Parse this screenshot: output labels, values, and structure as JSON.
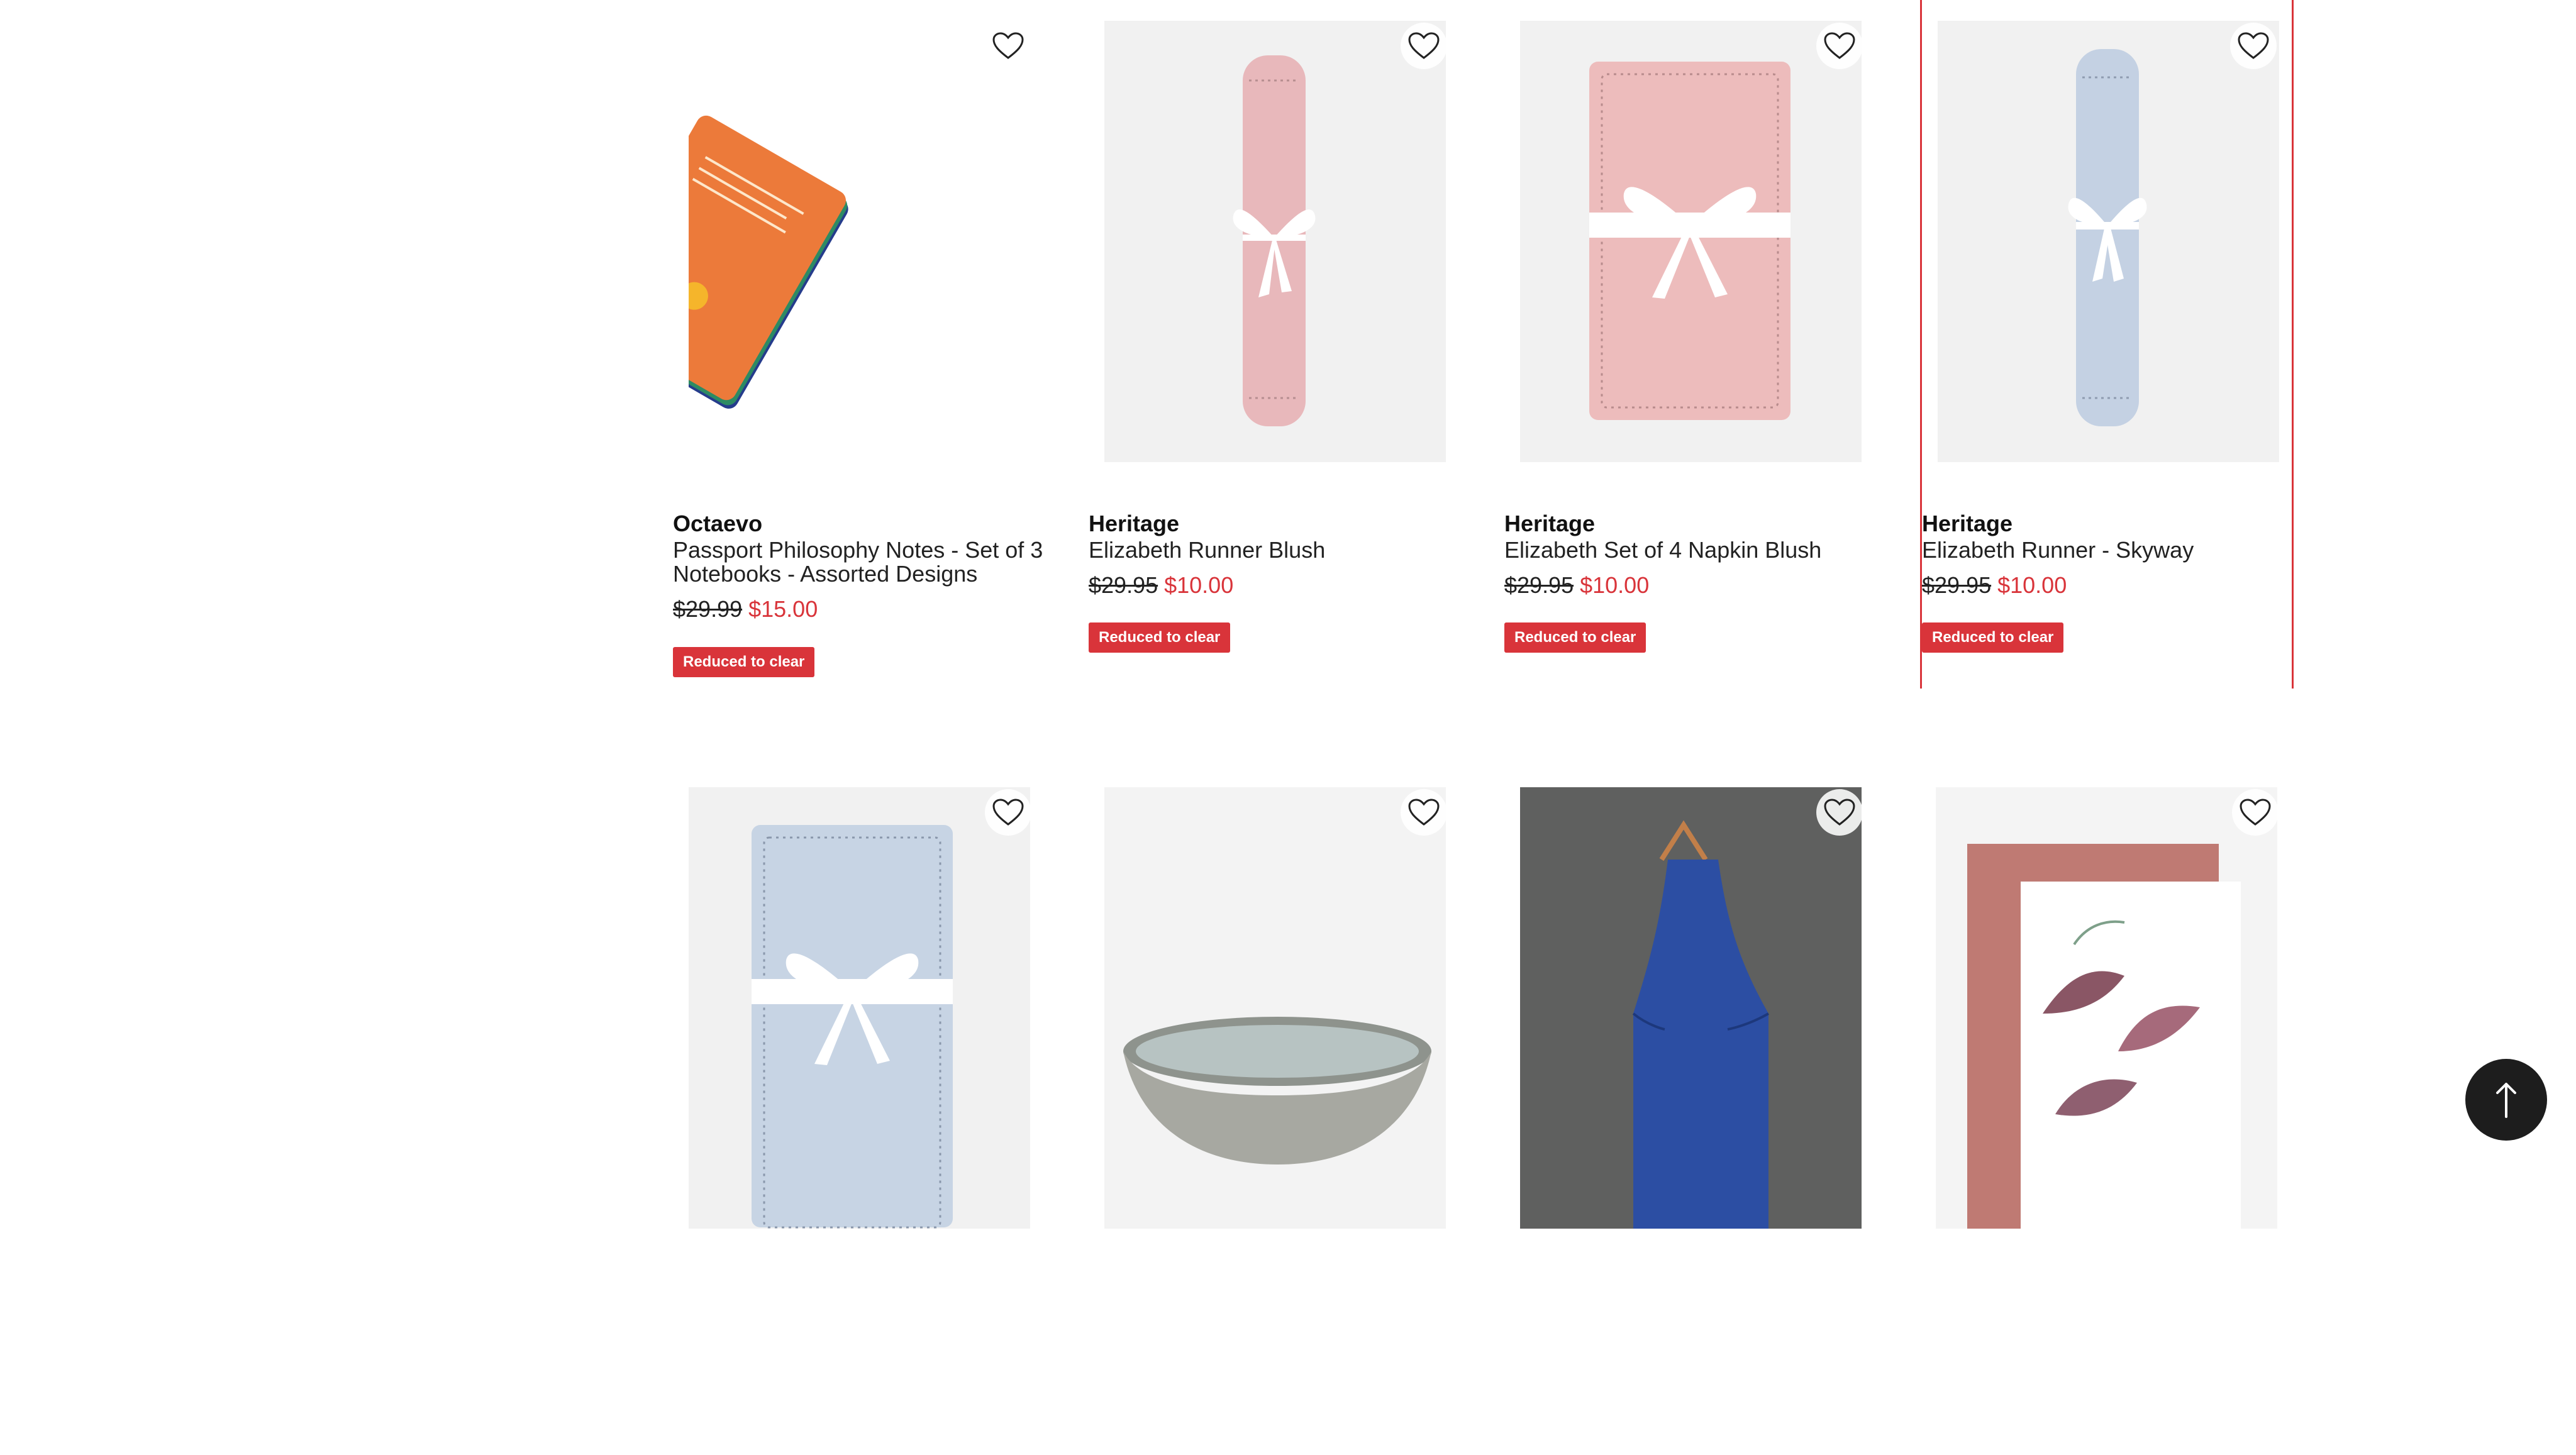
{
  "products": [
    {
      "brand": "Octaevo",
      "title": "Passport Philosophy Notes - Set of 3 Notebooks - Assorted Designs",
      "price_old": "$29.99",
      "price_new": "$15.00",
      "badge": "Reduced to clear",
      "image": "orange-notebook-set"
    },
    {
      "brand": "Heritage",
      "title": "Elizabeth Runner Blush",
      "price_old": "$29.95",
      "price_new": "$10.00",
      "badge": "Reduced to clear",
      "image": "pink-rolled-runner"
    },
    {
      "brand": "Heritage",
      "title": "Elizabeth Set of 4 Napkin Blush",
      "price_old": "$29.95",
      "price_new": "$10.00",
      "badge": "Reduced to clear",
      "image": "pink-folded-napkins"
    },
    {
      "brand": "Heritage",
      "title": "Elizabeth Runner - Skyway",
      "price_old": "$29.95",
      "price_new": "$10.00",
      "badge": "Reduced to clear",
      "image": "blue-rolled-runner"
    },
    {
      "image": "blue-folded-napkins"
    },
    {
      "image": "grey-ceramic-bowl"
    },
    {
      "image": "blue-apron-on-hanger"
    },
    {
      "image": "floral-tea-towels"
    }
  ],
  "icons": {
    "wishlist": "heart-outline-icon",
    "back_to_top": "arrow-up-icon"
  },
  "colors": {
    "accent_red": "#d9343a",
    "back_to_top_bg": "#1d1d1d"
  }
}
